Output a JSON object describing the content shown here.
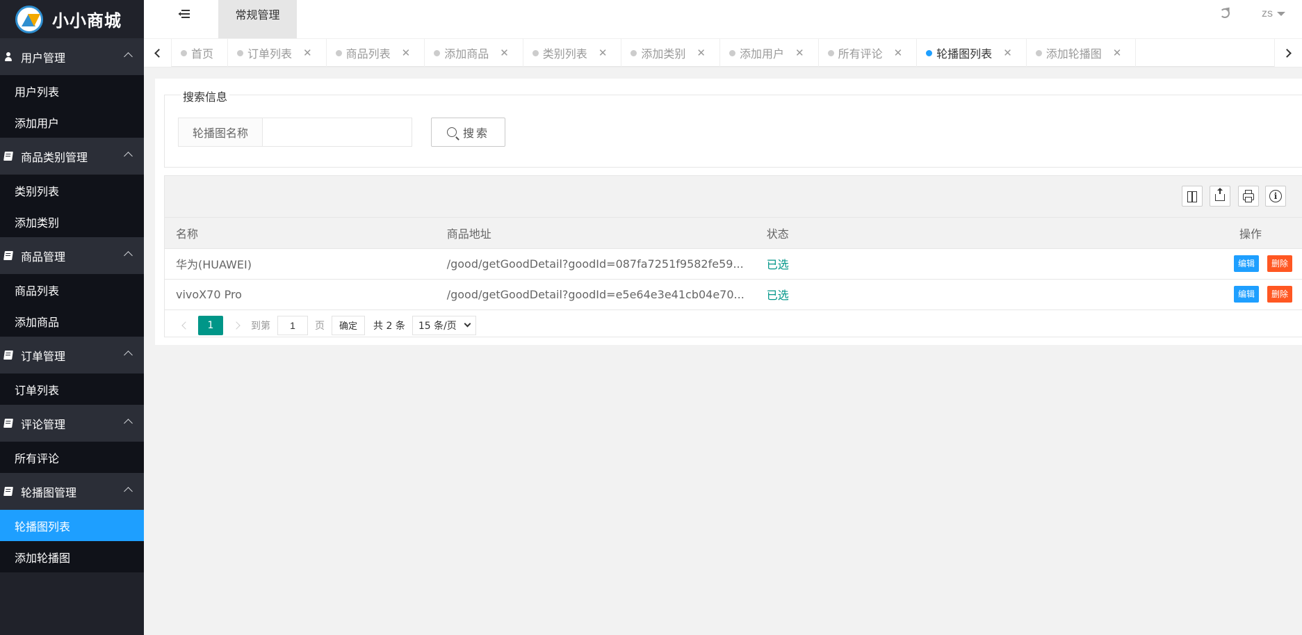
{
  "app": {
    "title": "小小商城"
  },
  "header": {
    "tab": "常规管理",
    "user": "zs"
  },
  "sidebar": {
    "groups": [
      {
        "label": "用户管理",
        "items": [
          "用户列表",
          "添加用户"
        ]
      },
      {
        "label": "商品类别管理",
        "items": [
          "类别列表",
          "添加类别"
        ]
      },
      {
        "label": "商品管理",
        "items": [
          "商品列表",
          "添加商品"
        ]
      },
      {
        "label": "订单管理",
        "items": [
          "订单列表"
        ]
      },
      {
        "label": "评论管理",
        "items": [
          "所有评论"
        ]
      },
      {
        "label": "轮播图管理",
        "items": [
          "轮播图列表",
          "添加轮播图"
        ]
      }
    ],
    "active_item": "轮播图列表"
  },
  "tabs": [
    {
      "label": "首页",
      "closable": false
    },
    {
      "label": "订单列表",
      "closable": true
    },
    {
      "label": "商品列表",
      "closable": true
    },
    {
      "label": "添加商品",
      "closable": true
    },
    {
      "label": "类别列表",
      "closable": true
    },
    {
      "label": "添加类别",
      "closable": true
    },
    {
      "label": "添加用户",
      "closable": true
    },
    {
      "label": "所有评论",
      "closable": true
    },
    {
      "label": "轮播图列表",
      "closable": true,
      "active": true
    },
    {
      "label": "添加轮播图",
      "closable": true
    }
  ],
  "tab_close": "✕",
  "search": {
    "legend": "搜索信息",
    "field_label": "轮播图名称",
    "value": "",
    "placeholder": "",
    "button": "搜索"
  },
  "table": {
    "columns": [
      "名称",
      "商品地址",
      "状态",
      "操作"
    ],
    "rows": [
      {
        "name": "华为(HUAWEI)",
        "url": "/good/getGoodDetail?goodId=087fa7251f9582fe59...",
        "status": "已选"
      },
      {
        "name": "vivoX70 Pro",
        "url": "/good/getGoodDetail?goodId=e5e64e3e41cb04e70...",
        "status": "已选"
      }
    ],
    "edit_label": "编辑",
    "delete_label": "删除"
  },
  "pager": {
    "current": "1",
    "goto_prefix": "到第",
    "goto_value": "1",
    "goto_suffix": "页",
    "confirm": "确定",
    "total": "共 2 条",
    "page_size": "15 条/页"
  },
  "colors": {
    "sidebar_bg": "#20222a",
    "active_blue": "#1e9fff",
    "teal": "#009688",
    "danger": "#ff5722"
  }
}
